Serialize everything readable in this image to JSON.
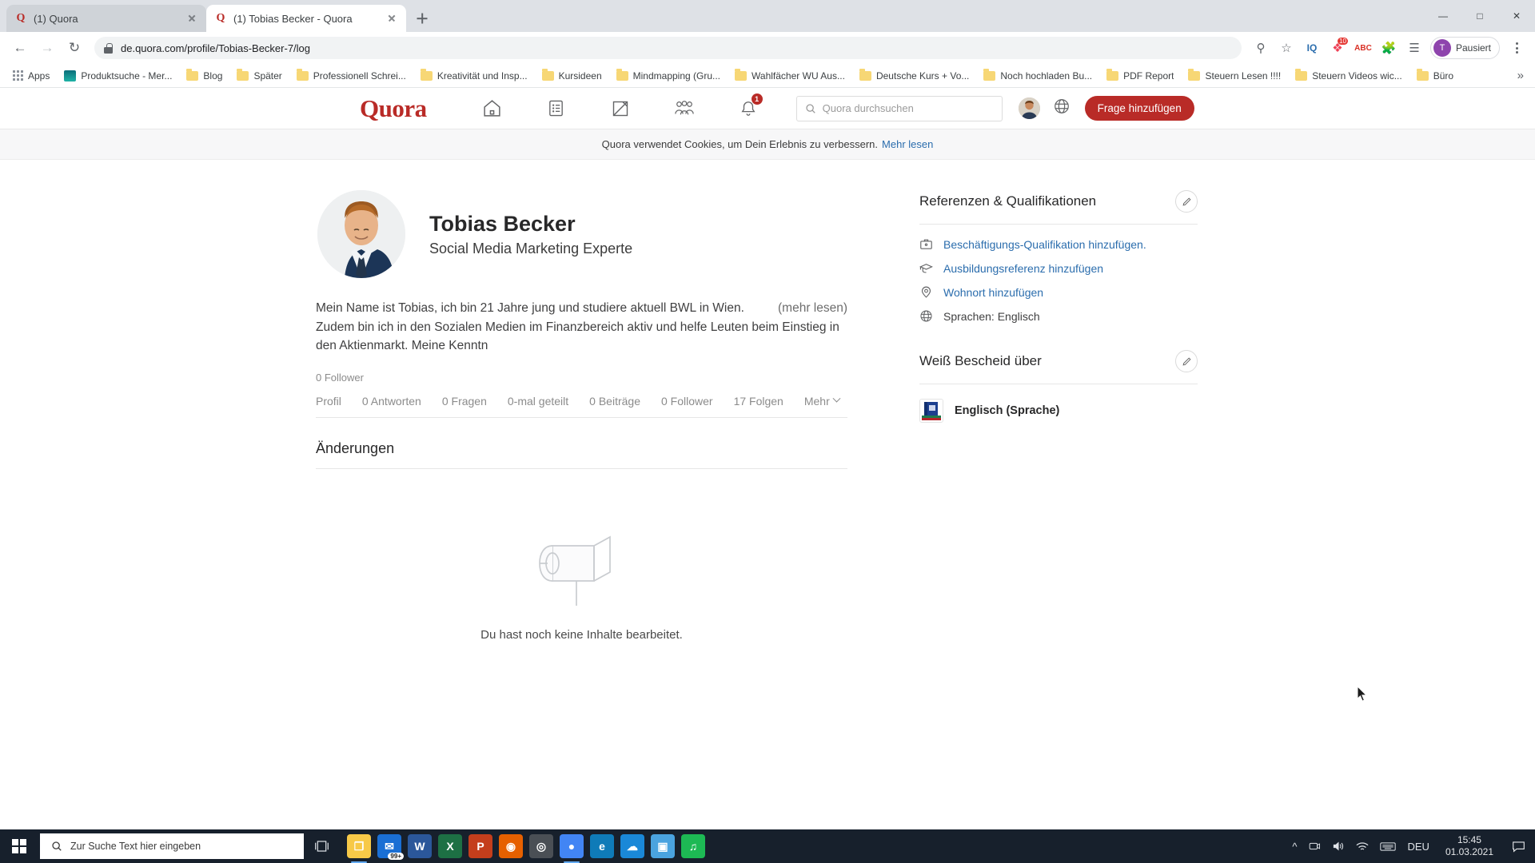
{
  "browser": {
    "tabs": [
      {
        "title": "(1) Quora",
        "favicon": "quora-icon",
        "active": false
      },
      {
        "title": "(1) Tobias Becker - Quora",
        "favicon": "quora-icon",
        "active": true
      }
    ],
    "new_tab_label": "+",
    "window_controls": {
      "minimize": "—",
      "maximize": "□",
      "close": "✕"
    },
    "nav": {
      "back": "←",
      "forward": "→",
      "reload": "↻"
    },
    "url": "de.quora.com/profile/Tobias-Becker-7/log",
    "omnibox_icons": [
      "zoom-icon",
      "star-icon",
      "iq-extension-icon",
      "pocket-extension-icon",
      "abc-extension-icon",
      "puzzle-extension-icon",
      "reading-list-icon"
    ],
    "extension_badge": "10",
    "profile_pill": {
      "initial": "T",
      "label": "Pausiert"
    },
    "bookmarks": [
      {
        "label": "Apps",
        "icon": "apps-grid-icon"
      },
      {
        "label": "Produktsuche - Mer...",
        "icon": "site-thumbnail-icon"
      },
      {
        "label": "Blog",
        "icon": "folder-icon"
      },
      {
        "label": "Später",
        "icon": "folder-icon"
      },
      {
        "label": "Professionell Schrei...",
        "icon": "folder-icon"
      },
      {
        "label": "Kreativität und Insp...",
        "icon": "folder-icon"
      },
      {
        "label": "Kursideen",
        "icon": "folder-icon"
      },
      {
        "label": "Mindmapping  (Gru...",
        "icon": "folder-icon"
      },
      {
        "label": "Wahlfächer WU Aus...",
        "icon": "folder-icon"
      },
      {
        "label": "Deutsche Kurs + Vo...",
        "icon": "folder-icon"
      },
      {
        "label": "Noch hochladen Bu...",
        "icon": "folder-icon"
      },
      {
        "label": "PDF Report",
        "icon": "folder-icon"
      },
      {
        "label": "Steuern Lesen !!!!",
        "icon": "folder-icon"
      },
      {
        "label": "Steuern Videos wic...",
        "icon": "folder-icon"
      },
      {
        "label": "Büro",
        "icon": "folder-icon"
      }
    ],
    "bookmarks_overflow": "»"
  },
  "quora_header": {
    "logo": "Quora",
    "nav": [
      {
        "name": "home-icon",
        "label": "Startseite"
      },
      {
        "name": "answers-list-icon",
        "label": "Antworten"
      },
      {
        "name": "write-pencil-icon",
        "label": "Schreiben"
      },
      {
        "name": "spaces-group-icon",
        "label": "Spaces"
      },
      {
        "name": "notifications-bell-icon",
        "label": "Benachrichtigungen",
        "badge": "1"
      }
    ],
    "search_placeholder": "Quora durchsuchen",
    "globe_icon": "language-globe-icon",
    "cta_label": "Frage hinzufügen",
    "brand_color": "#b92b27"
  },
  "cookie_banner": {
    "text": "Quora verwendet Cookies, um Dein Erlebnis zu verbessern.",
    "link": "Mehr lesen"
  },
  "profile": {
    "name": "Tobias Becker",
    "tagline": "Social Media Marketing Experte",
    "bio": "Mein Name ist Tobias, ich bin 21 Jahre jung und studiere aktuell BWL in Wien. Zudem bin ich in den Sozialen Medien im Finanzbereich aktiv und helfe Leuten beim Einstieg in den Aktienmarkt. Meine Kenntn",
    "more_link": "(mehr lesen)",
    "followers": "0 Follower",
    "tabs": [
      "Profil",
      "0 Antworten",
      "0 Fragen",
      "0-mal geteilt",
      "0 Beiträge",
      "0 Follower",
      "17 Folgen"
    ],
    "more_tab": "Mehr",
    "section_title": "Änderungen",
    "empty_state": "Du hast noch keine Inhalte bearbeitet."
  },
  "sidebar": {
    "credentials": {
      "title": "Referenzen & Qualifikationen",
      "edit_icon": "pencil-edit-icon",
      "items": [
        {
          "label": "Beschäftigungs-Qualifikation hinzufügen.",
          "icon": "briefcase-icon",
          "style": "link"
        },
        {
          "label": "Ausbildungsreferenz hinzufügen",
          "icon": "graduation-cap-icon",
          "style": "link"
        },
        {
          "label": "Wohnort hinzufügen",
          "icon": "location-pin-icon",
          "style": "link"
        },
        {
          "label": "Sprachen: Englisch",
          "icon": "globe-icon",
          "style": "plain"
        }
      ]
    },
    "knows_about": {
      "title": "Weiß Bescheid über",
      "edit_icon": "pencil-edit-icon",
      "topics": [
        {
          "name": "Englisch (Sprache)",
          "icon": "book-topic-icon"
        }
      ]
    }
  },
  "taskbar": {
    "start_label": "Start",
    "search_placeholder": "Zur Suche Text hier eingeben",
    "task_view_icon": "task-view-icon",
    "apps": [
      {
        "name": "file-explorer-icon",
        "glyph": "❐",
        "color": "#f7c948",
        "running": true
      },
      {
        "name": "mail-icon",
        "glyph": "✉",
        "color": "#1a6fd4",
        "badge": "99+",
        "running": false
      },
      {
        "name": "word-icon",
        "glyph": "W",
        "color": "#2b579a",
        "running": false
      },
      {
        "name": "excel-icon",
        "glyph": "X",
        "color": "#1d7044",
        "running": false
      },
      {
        "name": "powerpoint-icon",
        "glyph": "P",
        "color": "#c43e1c",
        "running": false
      },
      {
        "name": "firefox-icon",
        "glyph": "◉",
        "color": "#e66000",
        "running": false
      },
      {
        "name": "obs-icon",
        "glyph": "◎",
        "color": "#4a4f55",
        "running": false
      },
      {
        "name": "chrome-icon",
        "glyph": "●",
        "color": "#4285f4",
        "running": true
      },
      {
        "name": "edge-icon",
        "glyph": "e",
        "color": "#0f7bb8",
        "running": false
      },
      {
        "name": "onedrive-icon",
        "glyph": "☁",
        "color": "#1a88d8",
        "running": false
      },
      {
        "name": "photos-icon",
        "glyph": "▣",
        "color": "#4aa3df",
        "running": false
      },
      {
        "name": "spotify-icon",
        "glyph": "♫",
        "color": "#1db954",
        "running": false
      }
    ],
    "tray": [
      {
        "name": "show-hidden-icons-chevron",
        "glyph": "⌃"
      },
      {
        "name": "onedrive-tray-icon",
        "glyph": "☁"
      },
      {
        "name": "volume-icon",
        "glyph": "🔊"
      },
      {
        "name": "wifi-icon",
        "glyph": "◠"
      },
      {
        "name": "keyboard-icon",
        "glyph": "⌨"
      }
    ],
    "language": "DEU",
    "time": "15:45",
    "date": "01.03.2021",
    "notification_icon": "action-center-icon"
  }
}
